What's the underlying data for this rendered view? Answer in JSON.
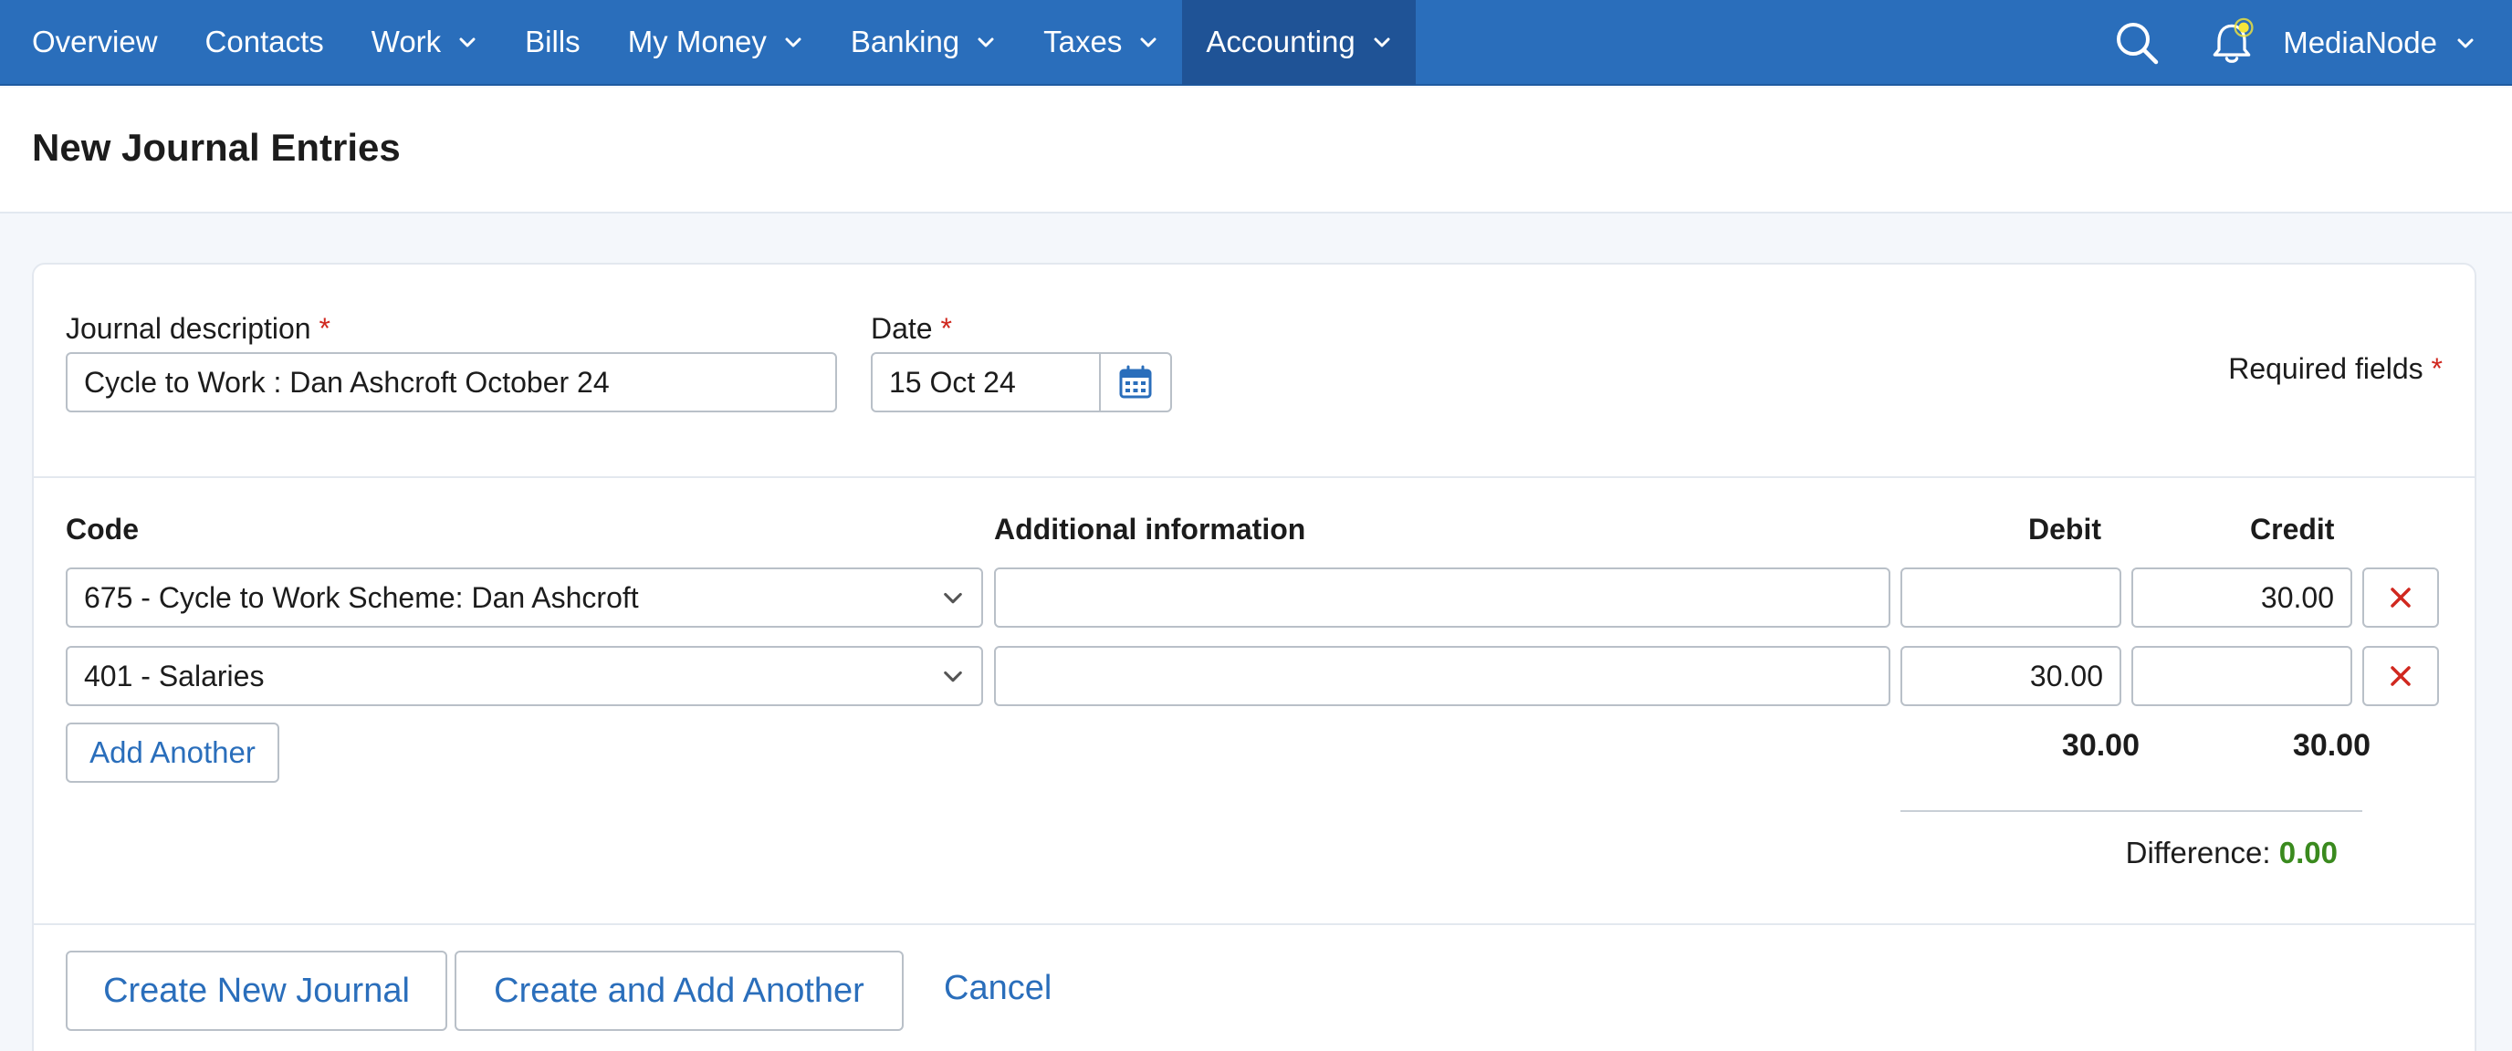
{
  "nav": {
    "items": [
      {
        "label": "Overview",
        "dropdown": false,
        "active": false
      },
      {
        "label": "Contacts",
        "dropdown": false,
        "active": false
      },
      {
        "label": "Work",
        "dropdown": true,
        "active": false
      },
      {
        "label": "Bills",
        "dropdown": false,
        "active": false
      },
      {
        "label": "My Money",
        "dropdown": true,
        "active": false
      },
      {
        "label": "Banking",
        "dropdown": true,
        "active": false
      },
      {
        "label": "Taxes",
        "dropdown": true,
        "active": false
      },
      {
        "label": "Accounting",
        "dropdown": true,
        "active": true
      }
    ],
    "user_label": "MediaNode",
    "search_icon": "search-icon",
    "bell_icon": "notification-bell-icon"
  },
  "page": {
    "title": "New Journal Entries"
  },
  "form": {
    "description_label": "Journal description",
    "required_mark": "*",
    "description_value": "Cycle to Work : Dan Ashcroft October 24",
    "date_label": "Date",
    "date_value": "15 Oct 24",
    "required_fields_label": "Required fields"
  },
  "table": {
    "headers": {
      "code": "Code",
      "additional": "Additional information",
      "debit": "Debit",
      "credit": "Credit"
    },
    "rows": [
      {
        "code": "675 - Cycle to Work Scheme: Dan Ashcroft",
        "additional": "",
        "debit": "",
        "credit": "30.00"
      },
      {
        "code": "401 - Salaries",
        "additional": "",
        "debit": "30.00",
        "credit": ""
      }
    ],
    "add_another_label": "Add Another",
    "total_debit": "30.00",
    "total_credit": "30.00",
    "difference_label": "Difference:",
    "difference_value": "0.00"
  },
  "actions": {
    "create_label": "Create New Journal",
    "create_add_label": "Create and Add Another",
    "cancel_label": "Cancel"
  },
  "colors": {
    "nav_bg": "#2a6ebb",
    "nav_active_bg": "#1f5396",
    "link": "#2a6ebb",
    "required": "#d0281f",
    "difference_ok": "#3a8a1e",
    "notification_dot": "#f5e63a"
  }
}
